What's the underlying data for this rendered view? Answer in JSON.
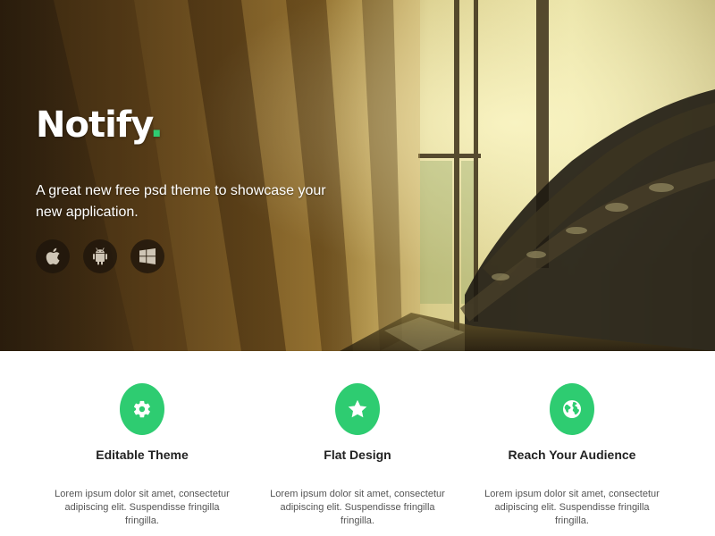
{
  "hero": {
    "brand_name": "Notify",
    "brand_dot": ".",
    "tagline": "A great new free psd theme to showcase your new application.",
    "platforms": [
      {
        "icon": "apple-icon"
      },
      {
        "icon": "android-icon"
      },
      {
        "icon": "windows-icon"
      }
    ]
  },
  "colors": {
    "accent": "#2ecc71",
    "heading_text": "#222222",
    "body_text": "#555555",
    "hero_text": "#ffffff"
  },
  "features": [
    {
      "icon": "gear-icon",
      "title": "Editable Theme",
      "text": "Lorem ipsum dolor sit amet, consectetur adipiscing elit. Suspendisse fringilla fringilla."
    },
    {
      "icon": "star-icon",
      "title": "Flat Design",
      "text": "Lorem ipsum dolor sit amet, consectetur adipiscing elit. Suspendisse fringilla fringilla."
    },
    {
      "icon": "globe-icon",
      "title": "Reach Your Audience",
      "text": "Lorem ipsum dolor sit amet, consectetur adipiscing elit. Suspendisse fringilla fringilla."
    }
  ]
}
